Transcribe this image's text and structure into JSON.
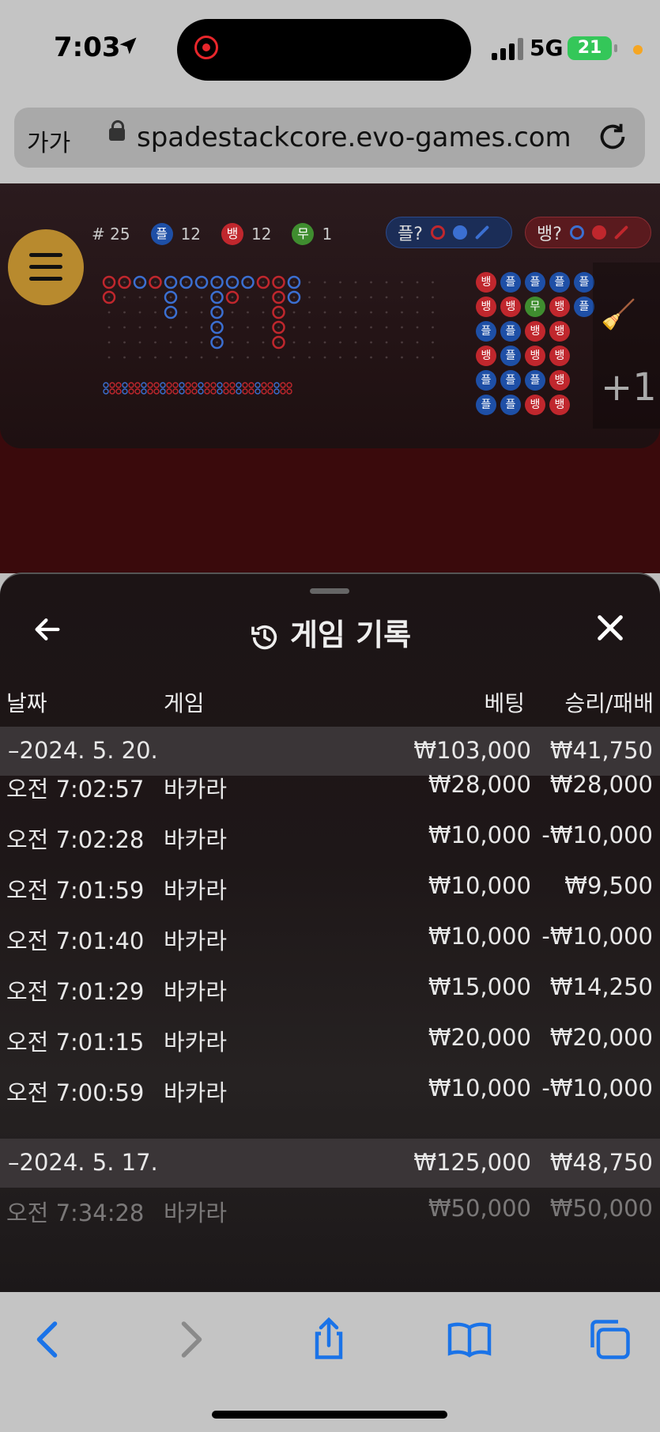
{
  "status_bar": {
    "time": "7:03",
    "network": "5G",
    "battery": "21"
  },
  "browser": {
    "text_size_label": "가가",
    "url": "spadestackcore.evo-games.com"
  },
  "scoreboard": {
    "round": "# 25",
    "player_badge": "플",
    "player_count": "12",
    "banker_badge": "뱅",
    "banker_count": "12",
    "tie_badge": "무",
    "tie_count": "1",
    "player_predict_label": "플?",
    "banker_predict_label": "뱅?",
    "plus_label": "+1",
    "bead_road": [
      [
        "뱅",
        "플",
        "플",
        "플",
        "플"
      ],
      [
        "뱅",
        "뱅",
        "무",
        "뱅",
        "플"
      ],
      [
        "플",
        "플",
        "뱅",
        "뱅"
      ],
      [
        "뱅",
        "플",
        "뱅",
        "뱅"
      ],
      [
        "플",
        "플",
        "플",
        "뱅"
      ],
      [
        "플",
        "플",
        "뱅",
        "뱅"
      ]
    ]
  },
  "history": {
    "title": "게임 기록",
    "columns": {
      "date": "날짜",
      "game": "게임",
      "bet": "베팅",
      "win_loss": "승리/패배"
    },
    "groups": [
      {
        "date": "–2024. 5. 20.",
        "total_bet": "₩103,000",
        "total_result": "₩41,750",
        "rows": [
          {
            "time": "오전 7:02:57",
            "game": "바카라",
            "bet": "₩28,000",
            "result": "₩28,000"
          },
          {
            "time": "오전 7:02:28",
            "game": "바카라",
            "bet": "₩10,000",
            "result": "-₩10,000"
          },
          {
            "time": "오전 7:01:59",
            "game": "바카라",
            "bet": "₩10,000",
            "result": "₩9,500"
          },
          {
            "time": "오전 7:01:40",
            "game": "바카라",
            "bet": "₩10,000",
            "result": "-₩10,000"
          },
          {
            "time": "오전 7:01:29",
            "game": "바카라",
            "bet": "₩15,000",
            "result": "₩14,250"
          },
          {
            "time": "오전 7:01:15",
            "game": "바카라",
            "bet": "₩20,000",
            "result": "₩20,000"
          },
          {
            "time": "오전 7:00:59",
            "game": "바카라",
            "bet": "₩10,000",
            "result": "-₩10,000"
          }
        ]
      },
      {
        "date": "–2024. 5. 17.",
        "total_bet": "₩125,000",
        "total_result": "₩48,750",
        "rows": [
          {
            "time": "오전 7:34:28",
            "game": "바카라",
            "bet": "₩50,000",
            "result": "₩50,000"
          }
        ]
      }
    ]
  },
  "colors": {
    "player": "#1e4fa6",
    "banker": "#c0272d",
    "tie": "#3f8d2f",
    "accent_gold": "#b88a2e",
    "ios_blue": "#1a73e8"
  }
}
